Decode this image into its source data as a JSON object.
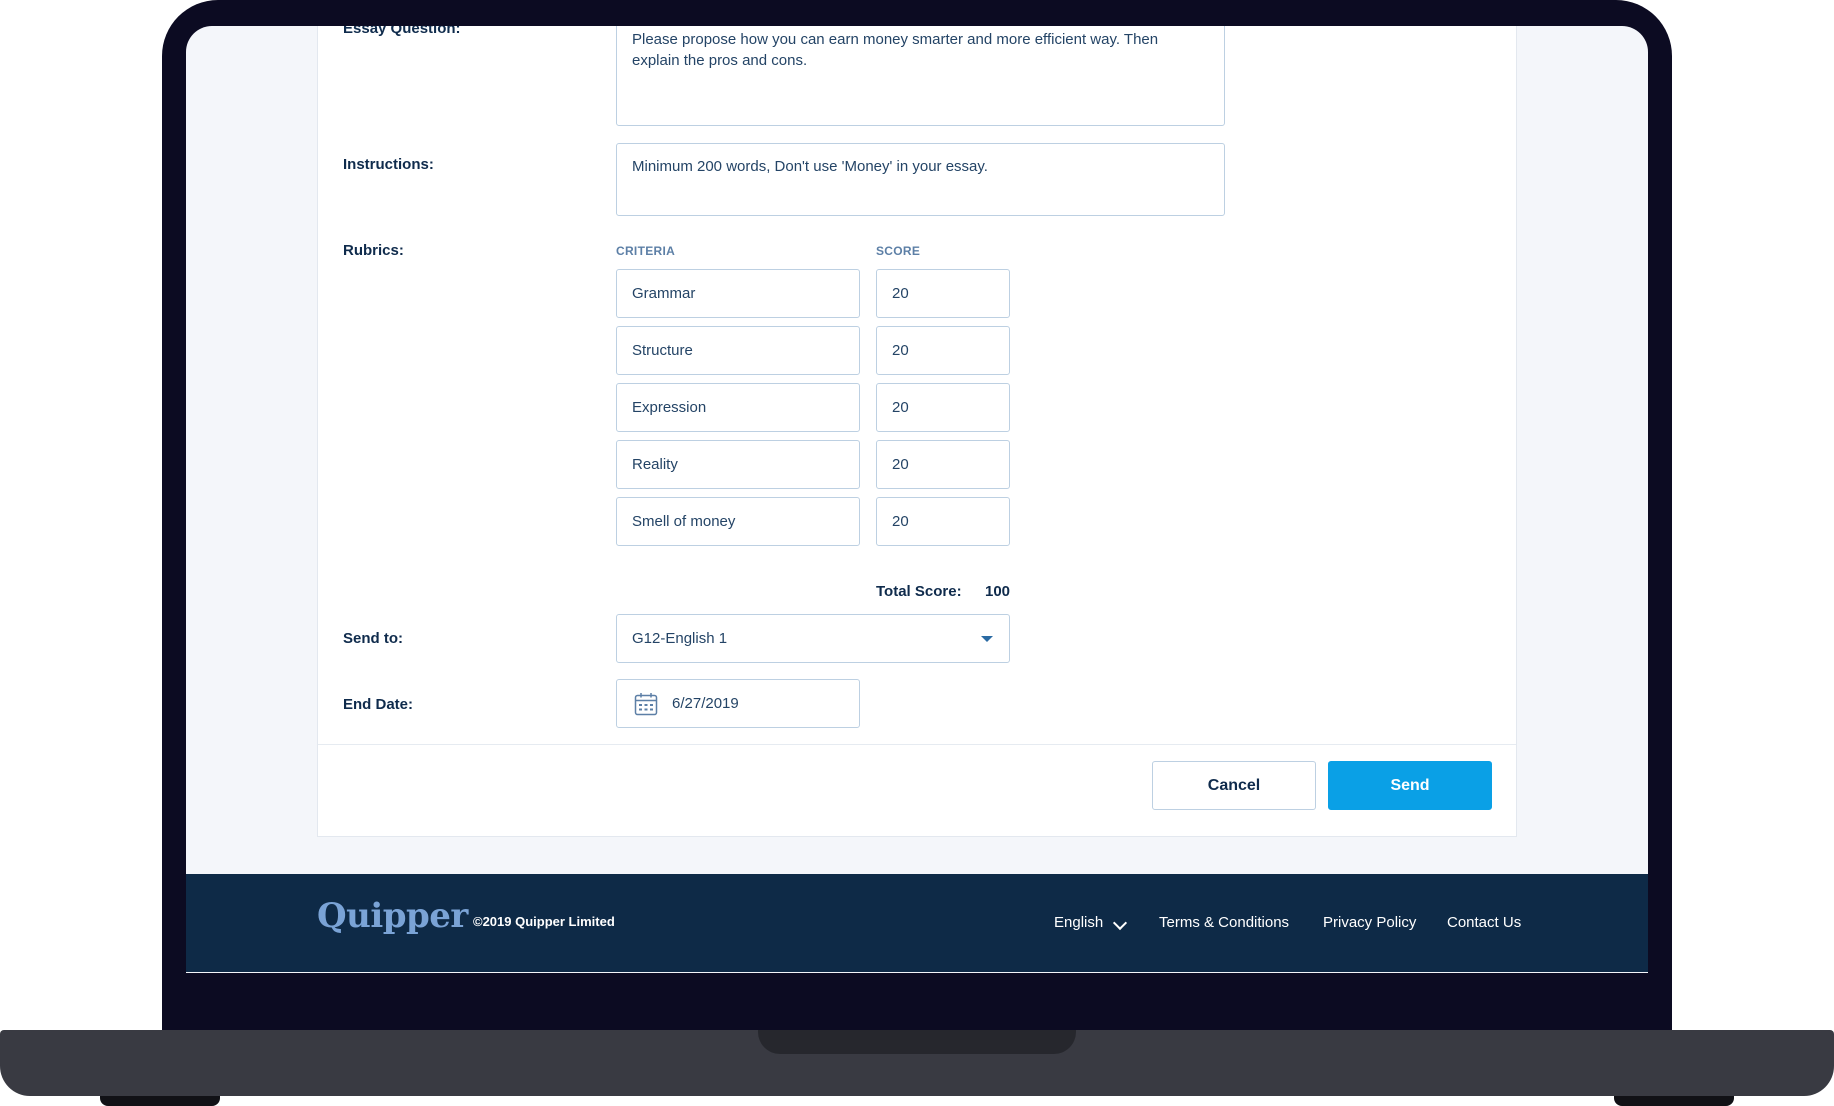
{
  "form": {
    "essay_question_label": "Essay Question:",
    "essay_question_value": "Please propose how you can earn money smarter and more efficient way. Then explain the pros and cons.",
    "instructions_label": "Instructions:",
    "instructions_value": "Minimum 200 words, Don't use 'Money' in your essay.",
    "rubrics_label": "Rubrics:",
    "criteria_header": "CRITERIA",
    "score_header": "SCORE",
    "rubrics": [
      {
        "criteria": "Grammar",
        "score": "20"
      },
      {
        "criteria": "Structure",
        "score": "20"
      },
      {
        "criteria": "Expression",
        "score": "20"
      },
      {
        "criteria": "Reality",
        "score": "20"
      },
      {
        "criteria": "Smell of money",
        "score": "20"
      }
    ],
    "total_score_label": "Total Score:",
    "total_score_value": "100",
    "send_to_label": "Send to:",
    "send_to_value": "G12-English 1",
    "end_date_label": "End Date:",
    "end_date_value": "6/27/2019",
    "cancel_label": "Cancel",
    "send_label": "Send"
  },
  "footer": {
    "logo": "Quipper",
    "copyright": "©2019 Quipper Limited",
    "language": "English",
    "terms": "Terms & Conditions",
    "privacy": "Privacy Policy",
    "contact": "Contact Us"
  },
  "colors": {
    "accent": "#0aa0e6",
    "footer_bg": "#0e2a47",
    "laptop_bezel": "#0c0b22"
  }
}
